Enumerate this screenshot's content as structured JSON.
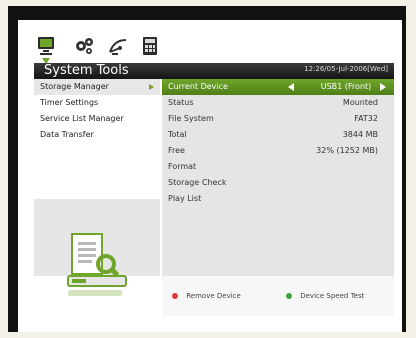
{
  "header": {
    "title": "System Tools",
    "datetime": "12:26/05-Jul-2006[Wed]"
  },
  "topbar": {
    "icons": [
      "monitor-icon",
      "gear-icon",
      "satellite-icon",
      "calculator-icon"
    ]
  },
  "menu": {
    "items": [
      {
        "label": "Storage Manager",
        "active": true
      },
      {
        "label": "Timer Settings",
        "active": false
      },
      {
        "label": "Service List Manager",
        "active": false
      },
      {
        "label": "Data Transfer",
        "active": false
      }
    ]
  },
  "details": {
    "rows": [
      {
        "label": "Current Device",
        "value": "USB1 (Front)",
        "selected": true
      },
      {
        "label": "Status",
        "value": "Mounted"
      },
      {
        "label": "File System",
        "value": "FAT32"
      },
      {
        "label": "Total",
        "value": "3844 MB"
      },
      {
        "label": "Free",
        "value": "32% (1252 MB)"
      },
      {
        "label": "Format",
        "value": ""
      },
      {
        "label": "Storage Check",
        "value": ""
      },
      {
        "label": "Play List",
        "value": ""
      }
    ]
  },
  "footer": {
    "red_label": "Remove Device",
    "green_label": "Device Speed Test",
    "colors": {
      "red": "#e23a3a",
      "green": "#40a040"
    }
  },
  "colors": {
    "accent_green": "#6fa52b",
    "title_bar": "#222222",
    "panel_grey": "#e5e5e5"
  }
}
